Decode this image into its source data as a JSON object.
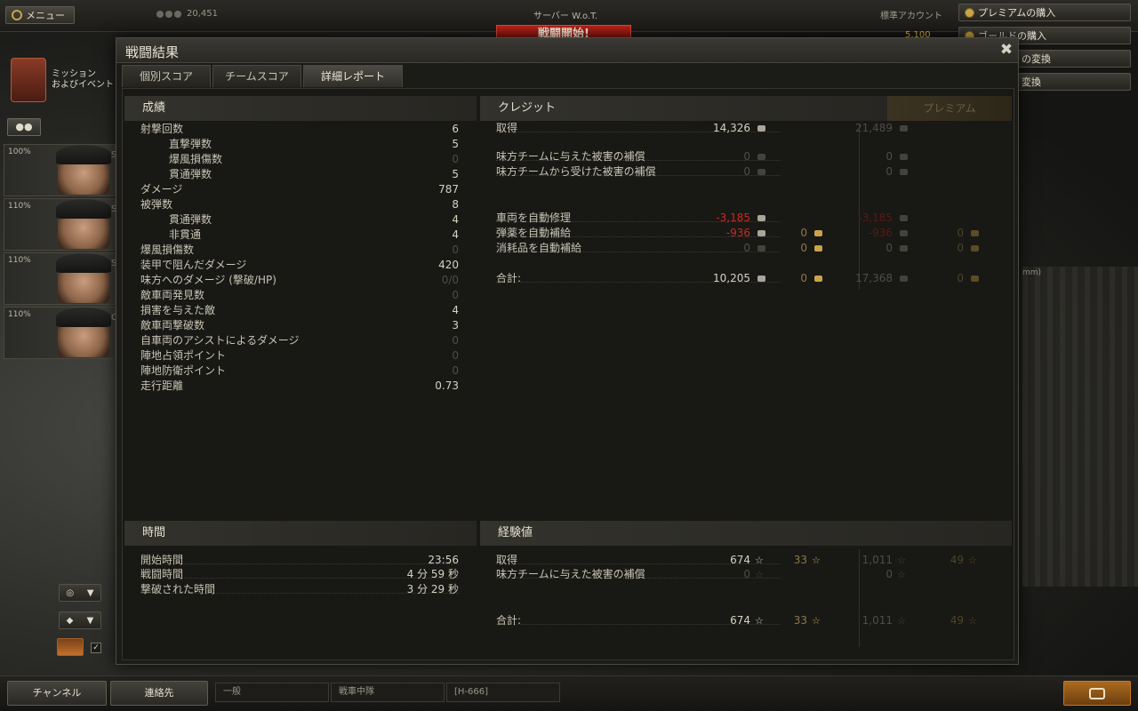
{
  "topbar": {
    "menu_label": "メニュー",
    "player_rating": "20,451",
    "server": "サーバー W.o.T.",
    "battle_button": "戦闘開始!",
    "account_type": "標準アカウント",
    "gold_amount": "5,100",
    "buy_premium": "プレミアムの購入",
    "buy_gold": "ゴールドの購入",
    "exchange_1": "の変換",
    "exchange_2": "変換"
  },
  "mission": {
    "line1": "ミッション",
    "line2": "およびイベント"
  },
  "crew": [
    {
      "pct": "100%",
      "letter": "S"
    },
    {
      "pct": "110%",
      "letter": "S"
    },
    {
      "pct": "110%",
      "letter": "S"
    },
    {
      "pct": "110%",
      "letter": "C"
    }
  ],
  "right_fragment": "mm)",
  "bottom": {
    "channel": "チャンネル",
    "contacts": "連絡先",
    "tab_general": "一般",
    "tab_platoon": "戦車中隊",
    "tab_clan": "[H-666]"
  },
  "dialog": {
    "title": "戦闘結果",
    "tabs": [
      "個別スコア",
      "チームスコア",
      "詳細レポート"
    ],
    "results": {
      "heading": "成績",
      "rows": [
        {
          "label": "射撃回数",
          "value": "6",
          "indent": false,
          "dim": false
        },
        {
          "label": "直撃弾数",
          "value": "5",
          "indent": true,
          "dim": false
        },
        {
          "label": "爆風損傷数",
          "value": "0",
          "indent": true,
          "dim": true
        },
        {
          "label": "貫通弾数",
          "value": "5",
          "indent": true,
          "dim": false
        },
        {
          "label": "ダメージ",
          "value": "787",
          "indent": false,
          "dim": false
        },
        {
          "label": "被弾数",
          "value": "8",
          "indent": false,
          "dim": false
        },
        {
          "label": "貫通弾数",
          "value": "4",
          "indent": true,
          "dim": false
        },
        {
          "label": "非貫通",
          "value": "4",
          "indent": true,
          "dim": false
        },
        {
          "label": "爆風損傷数",
          "value": "0",
          "indent": false,
          "dim": true
        },
        {
          "label": "装甲で阻んだダメージ",
          "value": "420",
          "indent": false,
          "dim": false
        },
        {
          "label": "味方へのダメージ (撃破/HP)",
          "value": "0/0",
          "indent": false,
          "dim": true
        },
        {
          "label": "敵車両発見数",
          "value": "0",
          "indent": false,
          "dim": true
        },
        {
          "label": "損害を与えた敵",
          "value": "4",
          "indent": false,
          "dim": false
        },
        {
          "label": "敵車両撃破数",
          "value": "3",
          "indent": false,
          "dim": false
        },
        {
          "label": "自車両のアシストによるダメージ",
          "value": "0",
          "indent": false,
          "dim": true
        },
        {
          "label": "陣地占領ポイント",
          "value": "0",
          "indent": false,
          "dim": true
        },
        {
          "label": "陣地防衛ポイント",
          "value": "0",
          "indent": false,
          "dim": true
        },
        {
          "label": "走行距離",
          "value": "0.73",
          "indent": false,
          "dim": false
        }
      ]
    },
    "credits": {
      "heading": "クレジット",
      "premium_heading": "プレミアム",
      "rows": [
        {
          "label": "取得",
          "c": "14,326",
          "cs": "",
          "g": "",
          "pc": "21,489",
          "pg": ""
        },
        {
          "label": "味方チームに与えた被害の補償",
          "c": "0",
          "cs": "dim",
          "g": "",
          "pc": "0",
          "pg": ""
        },
        {
          "label": "味方チームから受けた被害の補償",
          "c": "0",
          "cs": "dim",
          "g": "",
          "pc": "0",
          "pg": ""
        },
        {
          "label": "車両を自動修理",
          "c": "-3,185",
          "cs": "neg",
          "g": "",
          "pc": "-3,185",
          "pg": ""
        },
        {
          "label": "弾薬を自動補給",
          "c": "-936",
          "cs": "neg",
          "g": "0",
          "pc": "-936",
          "pg": "0"
        },
        {
          "label": "消耗品を自動補給",
          "c": "0",
          "cs": "dim",
          "g": "0",
          "pc": "0",
          "pg": "0"
        },
        {
          "label": "合計:",
          "c": "10,205",
          "cs": "",
          "g": "0",
          "pc": "17,368",
          "pg": "0"
        }
      ]
    },
    "time": {
      "heading": "時間",
      "rows": [
        {
          "label": "開始時間",
          "value": "23:56"
        },
        {
          "label": "戦闘時間",
          "value": "4 分 59 秒"
        },
        {
          "label": "撃破された時間",
          "value": "3 分 29 秒"
        }
      ]
    },
    "xp": {
      "heading": "経験値",
      "rows": [
        {
          "label": "取得",
          "x": "674",
          "xs": "",
          "f": "33",
          "px": "1,011",
          "pf": "49"
        },
        {
          "label": "味方チームに与えた被害の補償",
          "x": "0",
          "xs": "dim",
          "f": "",
          "px": "0",
          "pf": ""
        },
        {
          "label": "合計:",
          "x": "674",
          "xs": "",
          "f": "33",
          "px": "1,011",
          "pf": "49"
        }
      ]
    }
  }
}
